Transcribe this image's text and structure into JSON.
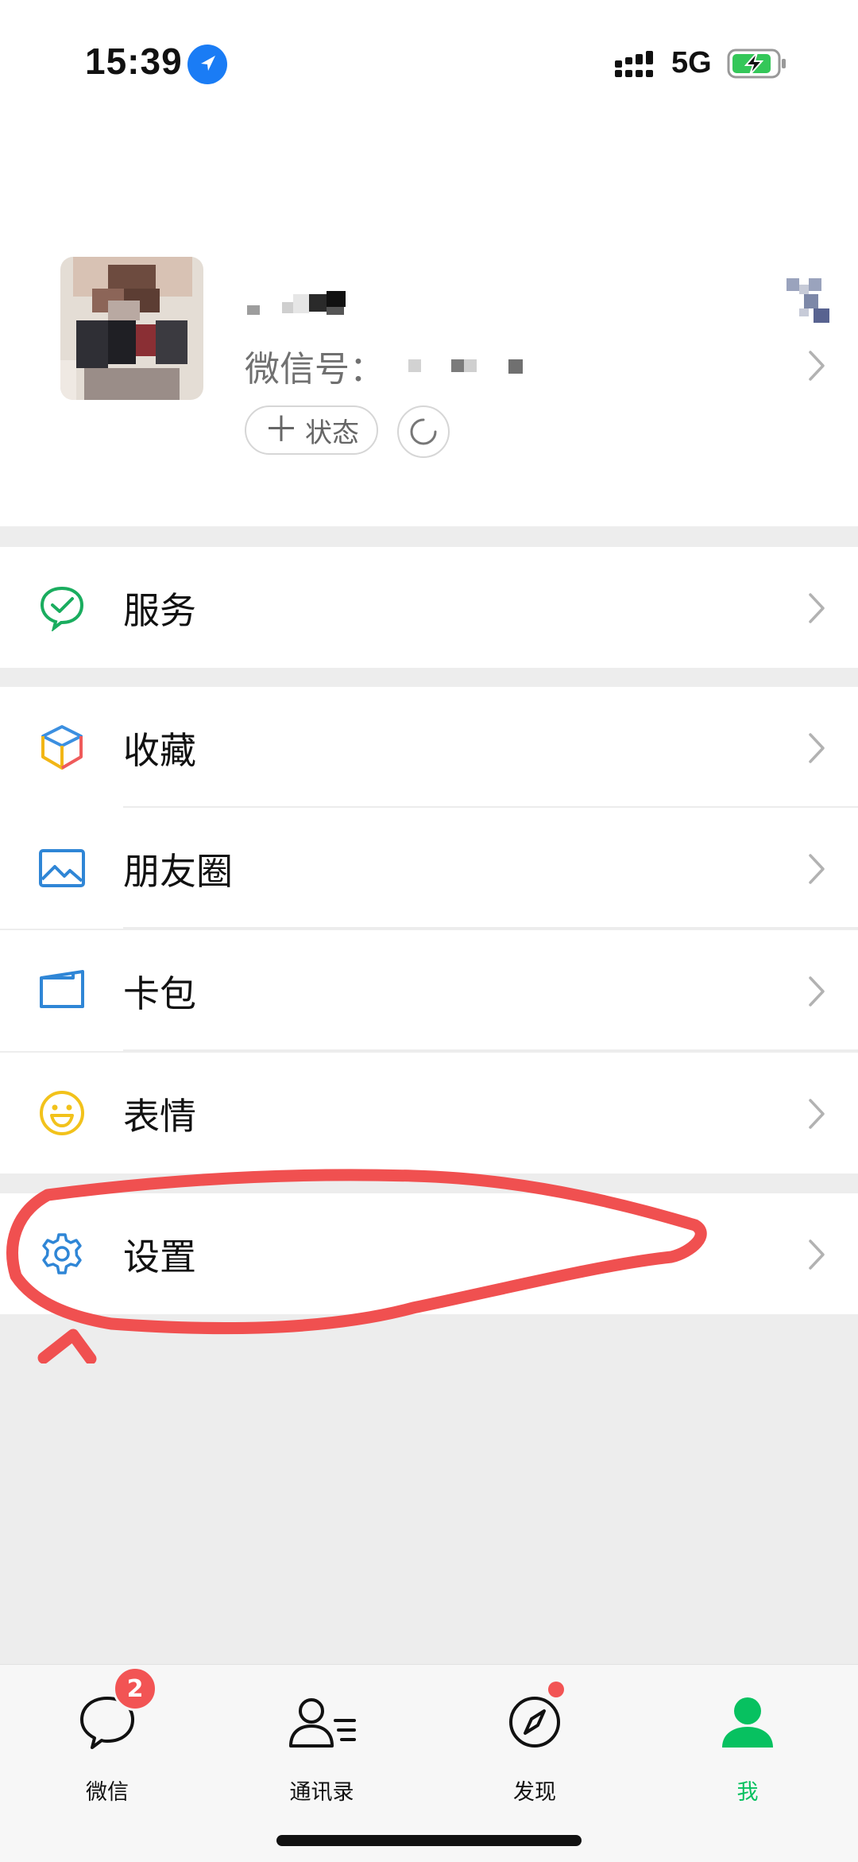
{
  "status_bar": {
    "time": "15:39",
    "network": "5G"
  },
  "profile": {
    "wechat_id_label": "微信号：",
    "status_button": "状态",
    "status_plus": "＋"
  },
  "menu": {
    "services": "服务",
    "favorites": "收藏",
    "moments": "朋友圈",
    "card_wallet": "卡包",
    "stickers": "表情",
    "settings": "设置"
  },
  "tabbar": {
    "tabs": [
      {
        "label": "微信",
        "badge": "2"
      },
      {
        "label": "通讯录"
      },
      {
        "label": "发现"
      },
      {
        "label": "我",
        "active": true
      }
    ]
  },
  "colors": {
    "accent_green": "#07c160",
    "badge_red": "#f25454",
    "annotation_red": "#f05050"
  }
}
